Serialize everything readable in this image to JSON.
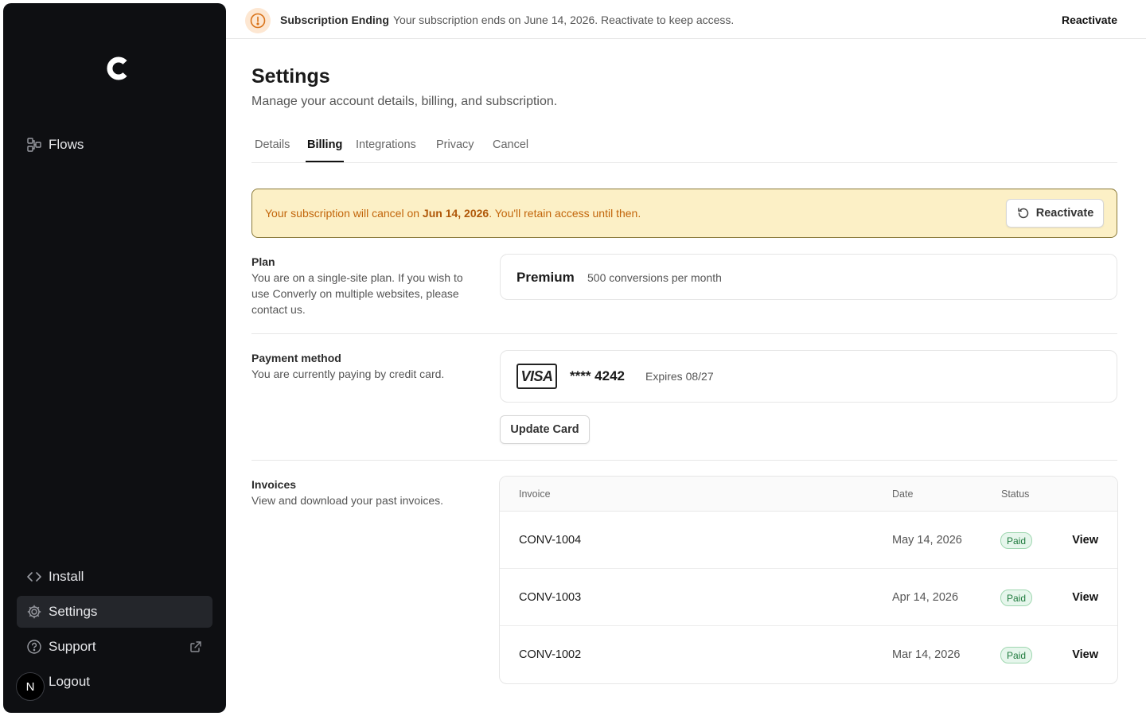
{
  "sidebar": {
    "logo_icon": "brand-c-logo",
    "items": [
      {
        "label": "Flows",
        "icon": "flows-icon"
      },
      {
        "label": "Install",
        "icon": "code-icon"
      },
      {
        "label": "Settings",
        "icon": "gear-icon"
      },
      {
        "label": "Support",
        "icon": "help-circle-icon"
      }
    ],
    "avatar_initial": "N",
    "logout_label": "Logout"
  },
  "banner": {
    "icon": "alert-circle-icon",
    "title": "Subscription Ending",
    "message": "Your subscription ends on June 14, 2026. Reactivate to keep access.",
    "action_label": "Reactivate"
  },
  "header": {
    "title": "Settings",
    "subtitle": "Manage your account details, billing, and subscription."
  },
  "tabs": [
    {
      "label": "Details"
    },
    {
      "label": "Billing",
      "active": true
    },
    {
      "label": "Integrations"
    },
    {
      "label": "Privacy"
    },
    {
      "label": "Cancel"
    }
  ],
  "alert": {
    "text_before": "Your subscription will cancel on ",
    "date": "Jun 14, 2026",
    "text_after": ". You'll retain access until then.",
    "button_label": "Reactivate"
  },
  "plan": {
    "title": "Plan",
    "description": "You are on a single-site plan. If you wish to use Converly on multiple websites, please contact us.",
    "name": "Premium",
    "detail": "500 conversions per month"
  },
  "payment": {
    "title": "Payment method",
    "description": "You are currently paying by credit card.",
    "brand": "VISA",
    "number": "**** 4242",
    "expires": "Expires 08/27",
    "update_label": "Update Card"
  },
  "invoices": {
    "title": "Invoices",
    "description": "View and download your past invoices.",
    "columns": [
      "Invoice",
      "Date",
      "Status"
    ],
    "rows": [
      {
        "id": "CONV-1004",
        "date": "May 14, 2026",
        "status": "Paid",
        "action": "View"
      },
      {
        "id": "CONV-1003",
        "date": "Apr 14, 2026",
        "status": "Paid",
        "action": "View"
      },
      {
        "id": "CONV-1002",
        "date": "Mar 14, 2026",
        "status": "Paid",
        "action": "View"
      }
    ]
  },
  "colors": {
    "sidebar_bg": "#0e0f12",
    "alert_bg": "#fcf0c6",
    "alert_text": "#c2650a",
    "paid_badge": "#1f7a3d"
  }
}
